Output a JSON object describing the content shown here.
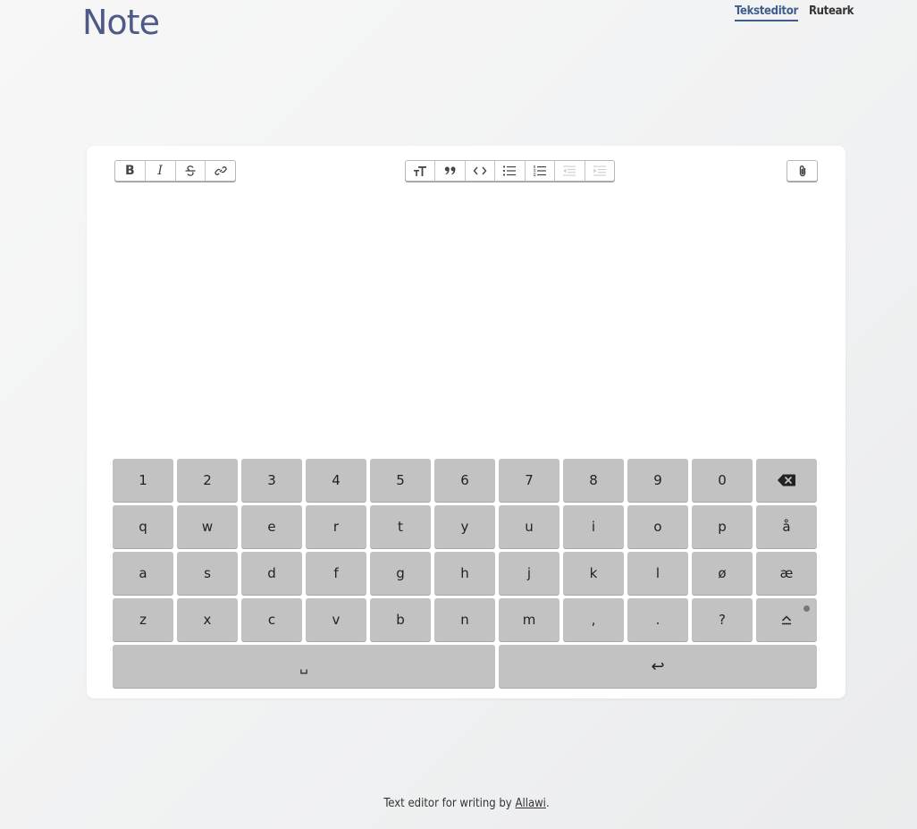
{
  "app": {
    "title": "Note"
  },
  "nav": {
    "texteditor": "Teksteditor",
    "spreadsheet": "Ruteark",
    "active": "Teksteditor"
  },
  "toolbar": {
    "left": [
      "bold",
      "italic",
      "strikethrough",
      "link"
    ],
    "bold_label": "B",
    "italic_label": "I",
    "middle": [
      "text-size",
      "quote",
      "code",
      "bullet-list",
      "numbered-list",
      "outdent",
      "indent"
    ],
    "right": [
      "attachment"
    ]
  },
  "editor": {
    "content": ""
  },
  "keyboard": {
    "row1": [
      "1",
      "2",
      "3",
      "4",
      "5",
      "6",
      "7",
      "8",
      "9",
      "0"
    ],
    "row2": [
      "q",
      "w",
      "e",
      "r",
      "t",
      "y",
      "u",
      "i",
      "o",
      "p",
      "å"
    ],
    "row3": [
      "a",
      "s",
      "d",
      "f",
      "g",
      "h",
      "j",
      "k",
      "l",
      "ø",
      "æ"
    ],
    "row4": [
      "z",
      "x",
      "c",
      "v",
      "b",
      "n",
      "m",
      ",",
      ".",
      "?"
    ],
    "backspace_icon": "backspace-icon",
    "shift_icon": "shift-icon",
    "space_symbol": "␣",
    "enter_symbol": "↩"
  },
  "footer": {
    "text": "Text editor for writing by ",
    "author": "Allawi",
    "suffix": "."
  },
  "colors": {
    "brand": "#4e5a86",
    "nav_active": "#3e5d8a",
    "key": "#c2c2c2",
    "card": "#ffffff"
  }
}
